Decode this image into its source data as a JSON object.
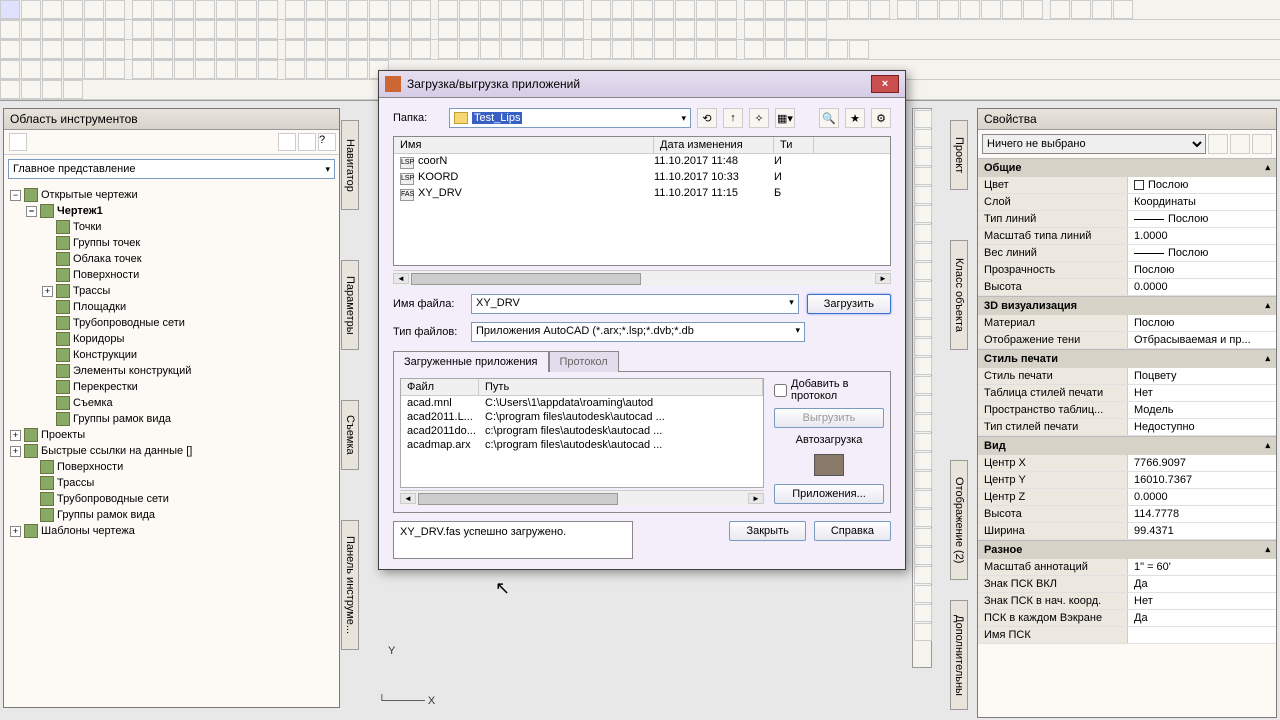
{
  "left_panel": {
    "title": "Область инструментов",
    "view": "Главное представление",
    "tree": [
      {
        "lvl": 0,
        "exp": "−",
        "label": "Открытые чертежи",
        "bold": false
      },
      {
        "lvl": 1,
        "exp": "−",
        "label": "Чертеж1",
        "bold": true
      },
      {
        "lvl": 2,
        "exp": "",
        "label": "Точки"
      },
      {
        "lvl": 2,
        "exp": "",
        "label": "Группы точек"
      },
      {
        "lvl": 2,
        "exp": "",
        "label": "Облака точек"
      },
      {
        "lvl": 2,
        "exp": "",
        "label": "Поверхности"
      },
      {
        "lvl": 2,
        "exp": "+",
        "label": "Трассы"
      },
      {
        "lvl": 2,
        "exp": "",
        "label": "Площадки"
      },
      {
        "lvl": 2,
        "exp": "",
        "label": "Трубопроводные сети"
      },
      {
        "lvl": 2,
        "exp": "",
        "label": "Коридоры"
      },
      {
        "lvl": 2,
        "exp": "",
        "label": "Конструкции"
      },
      {
        "lvl": 2,
        "exp": "",
        "label": "Элементы конструкций"
      },
      {
        "lvl": 2,
        "exp": "",
        "label": "Перекрестки"
      },
      {
        "lvl": 2,
        "exp": "",
        "label": "Съемка"
      },
      {
        "lvl": 2,
        "exp": "",
        "label": "Группы рамок вида"
      },
      {
        "lvl": 0,
        "exp": "+",
        "label": "Проекты"
      },
      {
        "lvl": 0,
        "exp": "+",
        "label": "Быстрые ссылки на данные []"
      },
      {
        "lvl": 1,
        "exp": "",
        "label": "Поверхности"
      },
      {
        "lvl": 1,
        "exp": "",
        "label": "Трассы"
      },
      {
        "lvl": 1,
        "exp": "",
        "label": "Трубопроводные сети"
      },
      {
        "lvl": 1,
        "exp": "",
        "label": "Группы рамок вида"
      },
      {
        "lvl": 0,
        "exp": "+",
        "label": "Шаблоны чертежа"
      }
    ]
  },
  "right_panel": {
    "title": "Свойства",
    "sel": "Ничего не выбрано",
    "groups": [
      {
        "name": "Общие",
        "rows": [
          {
            "k": "Цвет",
            "v": "Послою",
            "sw": true
          },
          {
            "k": "Слой",
            "v": "Координаты"
          },
          {
            "k": "Тип линий",
            "v": "Послою",
            "ln": true
          },
          {
            "k": "Масштаб типа линий",
            "v": "1.0000"
          },
          {
            "k": "Вес линий",
            "v": "Послою",
            "ln": true
          },
          {
            "k": "Прозрачность",
            "v": "Послою"
          },
          {
            "k": "Высота",
            "v": "0.0000"
          }
        ]
      },
      {
        "name": "3D визуализация",
        "rows": [
          {
            "k": "Материал",
            "v": "Послою"
          },
          {
            "k": "Отображение тени",
            "v": "Отбрасываемая и пр..."
          }
        ]
      },
      {
        "name": "Стиль печати",
        "rows": [
          {
            "k": "Стиль печати",
            "v": "Поцвету"
          },
          {
            "k": "Таблица стилей печати",
            "v": "Нет"
          },
          {
            "k": "Пространство таблиц...",
            "v": "Модель"
          },
          {
            "k": "Тип стилей печати",
            "v": "Недоступно"
          }
        ]
      },
      {
        "name": "Вид",
        "rows": [
          {
            "k": "Центр X",
            "v": "7766.9097"
          },
          {
            "k": "Центр Y",
            "v": "16010.7367"
          },
          {
            "k": "Центр Z",
            "v": "0.0000"
          },
          {
            "k": "Высота",
            "v": "114.7778"
          },
          {
            "k": "Ширина",
            "v": "99.4371"
          }
        ]
      },
      {
        "name": "Разное",
        "rows": [
          {
            "k": "Масштаб аннотаций",
            "v": "1\" = 60'"
          },
          {
            "k": "Знак ПСК ВКЛ",
            "v": "Да"
          },
          {
            "k": "Знак ПСК в нач. коорд.",
            "v": "Нет"
          },
          {
            "k": "ПСК в каждом Вэкране",
            "v": "Да"
          },
          {
            "k": "Имя ПСК",
            "v": ""
          }
        ]
      }
    ]
  },
  "dialog": {
    "title": "Загрузка/выгрузка приложений",
    "folder_lbl": "Папка:",
    "folder": "Test_Lips",
    "cols": {
      "name": "Имя",
      "date": "Дата изменения",
      "type": "Ти"
    },
    "files": [
      {
        "ico": "LSP",
        "name": "coorN",
        "date": "11.10.2017 11:48",
        "type": "И"
      },
      {
        "ico": "LSP",
        "name": "KOORD",
        "date": "11.10.2017 10:33",
        "type": "И"
      },
      {
        "ico": "FAS",
        "name": "XY_DRV",
        "date": "11.10.2017 11:15",
        "type": "Б"
      }
    ],
    "fname_lbl": "Имя файла:",
    "fname": "XY_DRV",
    "ftype_lbl": "Тип файлов:",
    "ftype": "Приложения AutoCAD (*.arx;*.lsp;*.dvb;*.db",
    "load": "Загрузить",
    "tab1": "Загруженные приложения",
    "tab2": "Протокол",
    "addlog": "Добавить в протокол",
    "unload": "Выгрузить",
    "autoload": "Автозагрузка",
    "apps_btn": "Приложения...",
    "l_cols": {
      "file": "Файл",
      "path": "Путь"
    },
    "loaded": [
      {
        "f": "acad.mnl",
        "p": "C:\\Users\\1\\appdata\\roaming\\autod"
      },
      {
        "f": "acad2011.L...",
        "p": "C:\\program files\\autodesk\\autocad ..."
      },
      {
        "f": "acad2011do...",
        "p": "c:\\program files\\autodesk\\autocad ..."
      },
      {
        "f": "acadmap.arx",
        "p": "c:\\program files\\autodesk\\autocad ..."
      }
    ],
    "status": "XY_DRV.fas успешно загружено.",
    "close": "Закрыть",
    "help": "Справка"
  },
  "vtabs": {
    "nav": "Навигатор",
    "params": "Параметры",
    "survey": "Съемка",
    "toolpal": "Панель инструме...",
    "project": "Проект",
    "objclass": "Класс объекта",
    "display": "Отображение (2)",
    "extra": "Дополнительны"
  }
}
